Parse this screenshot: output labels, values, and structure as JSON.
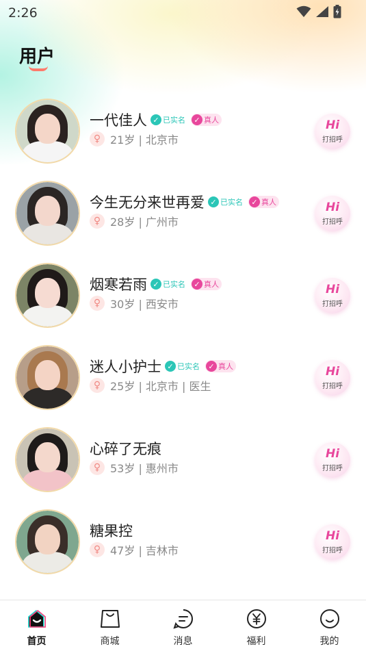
{
  "status_bar": {
    "time": "2:26",
    "icons": [
      "wifi-icon",
      "signal-icon",
      "battery-icon"
    ]
  },
  "page": {
    "title": "用户"
  },
  "users": [
    {
      "name": "一代佳人",
      "verified_label": "已实名",
      "real_label": "真人",
      "info": "21岁 | 北京市",
      "gender_icon": "female-icon",
      "avatar_colors": [
        "#cfd8c9",
        "#2a2220",
        "#f4d6c8",
        "#f5f5f5"
      ]
    },
    {
      "name": "今生无分来世再爱",
      "verified_label": "已实名",
      "real_label": "真人",
      "info": "28岁 | 广州市",
      "gender_icon": "female-icon",
      "avatar_colors": [
        "#9aa2a6",
        "#2b2624",
        "#f3d7cc",
        "#e9e6e2"
      ]
    },
    {
      "name": "烟寒若雨",
      "verified_label": "已实名",
      "real_label": "真人",
      "info": "30岁 | 西安市",
      "gender_icon": "female-icon",
      "avatar_colors": [
        "#7c8466",
        "#1f1a19",
        "#f6dbd2",
        "#f3f3f1"
      ]
    },
    {
      "name": "迷人小护士",
      "verified_label": "已实名",
      "real_label": "真人",
      "info": "25岁 | 北京市 | 医生",
      "gender_icon": "female-icon",
      "avatar_colors": [
        "#b79e89",
        "#a9794f",
        "#f4d4c5",
        "#2d2a28"
      ]
    },
    {
      "name": "心碎了无痕",
      "verified_label": "",
      "real_label": "",
      "info": "53岁 | 惠州市",
      "gender_icon": "female-icon",
      "avatar_colors": [
        "#c9c3b5",
        "#1e1b1a",
        "#f4d8cc",
        "#f2c3c8"
      ]
    },
    {
      "name": "糖果控",
      "verified_label": "",
      "real_label": "",
      "info": "47岁 | 吉林市",
      "gender_icon": "female-icon",
      "avatar_colors": [
        "#7fa78f",
        "#3a2e29",
        "#f2d3c2",
        "#ecebe6"
      ]
    }
  ],
  "greet_button": {
    "hi": "Hi",
    "label": "打招呼"
  },
  "tabs": [
    {
      "label": "首页",
      "icon": "home-icon",
      "active": true
    },
    {
      "label": "商城",
      "icon": "shopping-bag-icon",
      "active": false
    },
    {
      "label": "消息",
      "icon": "message-icon",
      "active": false
    },
    {
      "label": "福利",
      "icon": "yen-coin-icon",
      "active": false
    },
    {
      "label": "我的",
      "icon": "profile-face-icon",
      "active": false
    }
  ],
  "colors": {
    "accent_pink": "#e8479c",
    "verified_teal": "#2bc6b7",
    "title_underline": "#ff7a6b"
  }
}
